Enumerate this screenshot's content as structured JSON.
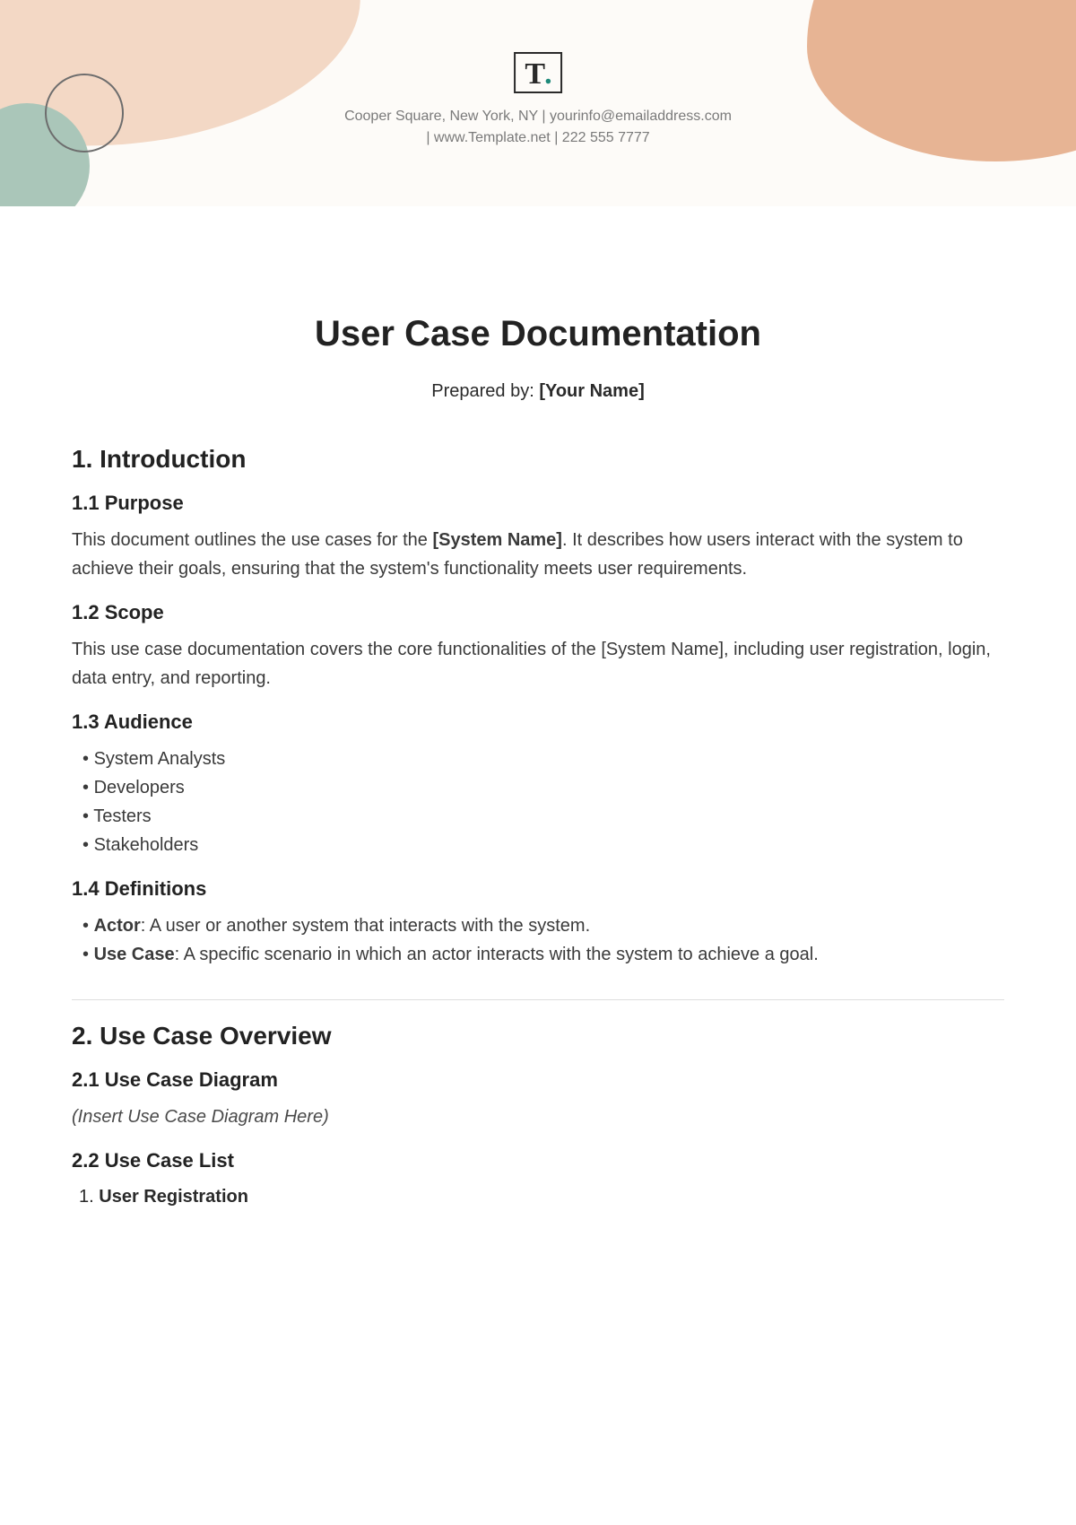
{
  "header": {
    "logo_text": "T",
    "logo_dot": ".",
    "contact_line1": "Cooper Square, New York, NY  |  yourinfo@emailaddress.com",
    "contact_line2": "|  www.Template.net  |  222 555 7777"
  },
  "doc": {
    "title": "User Case Documentation",
    "byline_label": "Prepared by: ",
    "byline_name": "[Your Name]"
  },
  "s1": {
    "heading": "1. Introduction",
    "s11_heading": "1.1 Purpose",
    "s11_pre": "This document outlines the use cases for the ",
    "s11_bold": "[System Name]",
    "s11_post": ". It describes how users interact with the system to achieve their goals, ensuring that the system's functionality meets user requirements.",
    "s12_heading": "1.2 Scope",
    "s12_para": "This use case documentation covers the core functionalities of the [System Name], including user registration, login, data entry, and reporting.",
    "s13_heading": "1.3 Audience",
    "audience": [
      "System Analysts",
      "Developers",
      "Testers",
      "Stakeholders"
    ],
    "s14_heading": "1.4 Definitions",
    "defs": [
      {
        "term": "Actor",
        "def": ": A user or another system that interacts with the system."
      },
      {
        "term": "Use Case",
        "def": ": A specific scenario in which an actor interacts with the system to achieve a goal."
      }
    ]
  },
  "s2": {
    "heading": "2. Use Case Overview",
    "s21_heading": "2.1 Use Case Diagram",
    "s21_placeholder": "(Insert Use Case Diagram Here)",
    "s22_heading": "2.2 Use Case List",
    "list": [
      {
        "num": "1.",
        "label": "User Registration"
      }
    ]
  }
}
